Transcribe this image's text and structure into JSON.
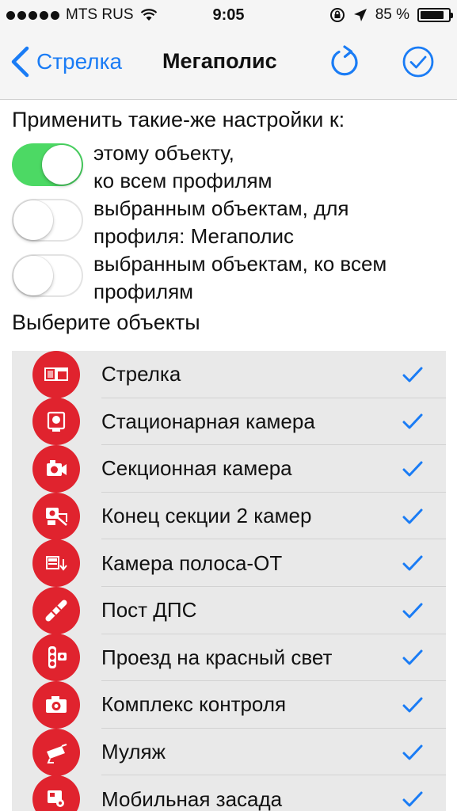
{
  "status_bar": {
    "carrier": "MTS RUS",
    "time": "9:05",
    "battery": "85 %",
    "battery_level": 0.85
  },
  "nav": {
    "back_label": "Стрелка",
    "title": "Мегаполис"
  },
  "apply_header": "Применить такие-же настройки к:",
  "options": [
    {
      "label": "этому объекту,\nко всем профилям",
      "on": true
    },
    {
      "label": "выбранным объектам, для\nпрофиля:  Мегаполис",
      "on": false
    },
    {
      "label": "выбранным объектам, ко всем\nпрофилям",
      "on": false
    }
  ],
  "section_title": "Выберите объекты",
  "items": [
    {
      "label": "Стрелка",
      "icon": "strelka-icon",
      "checked": true
    },
    {
      "label": "Стационарная камера",
      "icon": "stationary-camera-icon",
      "checked": true
    },
    {
      "label": "Секционная камера",
      "icon": "section-camera-icon",
      "checked": true
    },
    {
      "label": "Конец секции 2 камер",
      "icon": "section-end-icon",
      "checked": true
    },
    {
      "label": "Камера полоса-ОТ",
      "icon": "lane-camera-icon",
      "checked": true
    },
    {
      "label": "Пост ДПС",
      "icon": "police-post-icon",
      "checked": true
    },
    {
      "label": "Проезд на красный свет",
      "icon": "traffic-light-icon",
      "checked": true
    },
    {
      "label": "Комплекс контроля",
      "icon": "control-complex-icon",
      "checked": true
    },
    {
      "label": "Муляж",
      "icon": "dummy-camera-icon",
      "checked": true
    },
    {
      "label": "Мобильная засада",
      "icon": "mobile-ambush-icon",
      "checked": true
    }
  ],
  "colors": {
    "accent": "#1a7cf5",
    "toggle_on": "#4cd964",
    "badge": "#e0232e",
    "list_bg": "#e9e9e9"
  }
}
